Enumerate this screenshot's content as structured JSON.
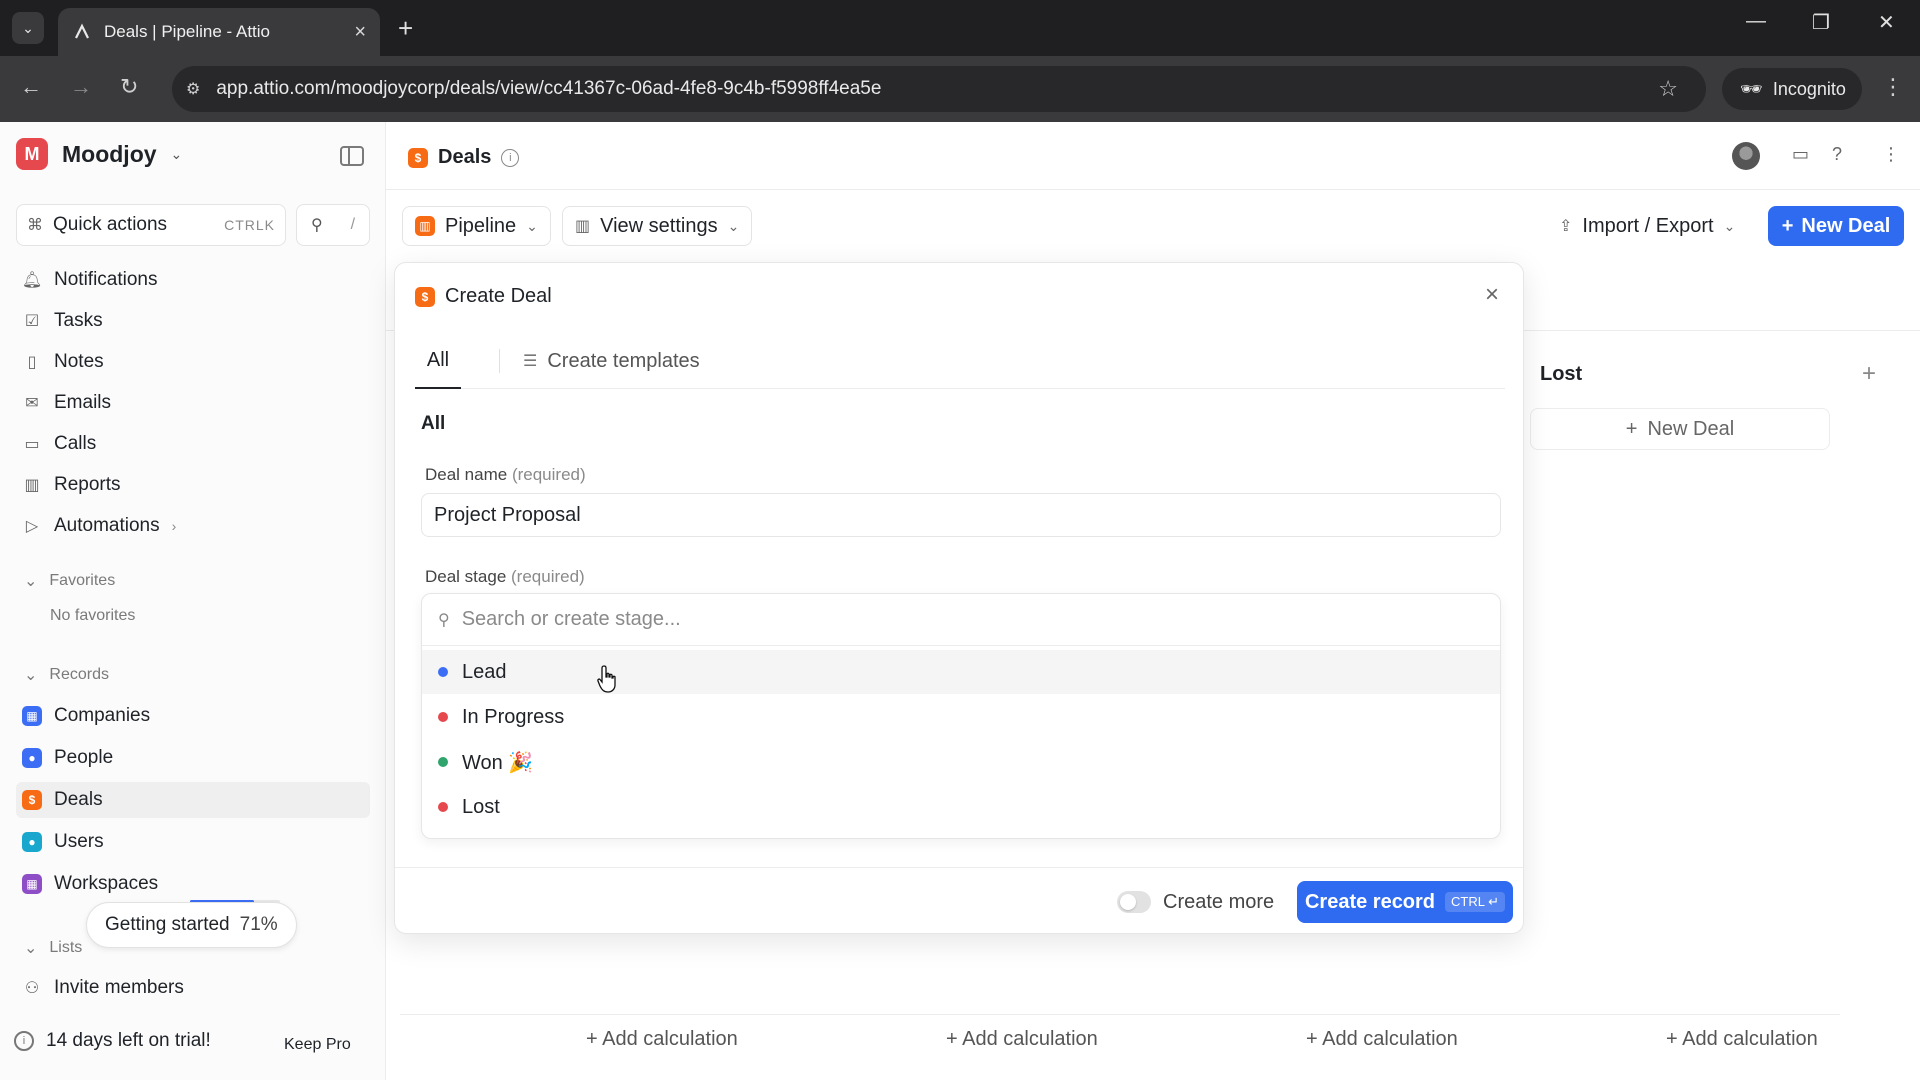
{
  "browser": {
    "tab_title": "Deals | Pipeline - Attio",
    "url": "app.attio.com/moodjoycorp/deals/view/cc41367c-06ad-4fe8-9c4b-f5998ff4ea5e",
    "incognito_label": "Incognito"
  },
  "sidebar": {
    "workspace": "Moodjoy",
    "workspace_initial": "M",
    "quick_actions": {
      "label": "Quick actions",
      "shortcut": "CTRLK",
      "search_shortcut": "/"
    },
    "nav": [
      {
        "label": "Notifications",
        "icon": "bell-icon"
      },
      {
        "label": "Tasks",
        "icon": "checkbox-icon"
      },
      {
        "label": "Notes",
        "icon": "note-icon"
      },
      {
        "label": "Emails",
        "icon": "mail-icon"
      },
      {
        "label": "Calls",
        "icon": "video-icon"
      },
      {
        "label": "Reports",
        "icon": "chart-icon"
      },
      {
        "label": "Automations",
        "icon": "play-icon"
      }
    ],
    "favorites": {
      "title": "Favorites",
      "empty": "No favorites"
    },
    "records": {
      "title": "Records",
      "items": [
        {
          "label": "Companies",
          "color": "#3b6ef5"
        },
        {
          "label": "People",
          "color": "#3b6ef5"
        },
        {
          "label": "Deals",
          "color": "#f76b15"
        },
        {
          "label": "Users",
          "color": "#19a7ce"
        },
        {
          "label": "Workspaces",
          "color": "#8e4ec6"
        }
      ]
    },
    "getting_started": {
      "label": "Getting started",
      "percent_label": "71%",
      "progress": 0.71
    },
    "lists": {
      "title": "Lists"
    },
    "invite": "Invite members",
    "trial": {
      "label": "14 days left on trial!",
      "action": "Keep Pro"
    }
  },
  "header": {
    "title": "Deals",
    "pipeline": "Pipeline",
    "view_settings": "View settings",
    "import_export": "Import / Export",
    "new_deal": "New Deal"
  },
  "board": {
    "lost_column": "Lost",
    "new_deal": "New Deal",
    "add_calculation": "+ Add calculation"
  },
  "modal": {
    "title": "Create Deal",
    "tabs": {
      "all": "All",
      "templates": "Create templates"
    },
    "section": "All",
    "deal_name": {
      "label": "Deal name",
      "req": "(required)",
      "value": "Project Proposal"
    },
    "deal_stage": {
      "label": "Deal stage",
      "req": "(required)",
      "placeholder": "Search or create stage...",
      "options": [
        {
          "label": "Lead",
          "color": "#3b6ef5"
        },
        {
          "label": "In Progress",
          "color": "#e5484d"
        },
        {
          "label": "Won 🎉",
          "color": "#30a46c"
        },
        {
          "label": "Lost",
          "color": "#e5484d"
        }
      ]
    },
    "create_more": "Create more",
    "create_record": "Create record",
    "create_shortcut": "CTRL ↵"
  }
}
